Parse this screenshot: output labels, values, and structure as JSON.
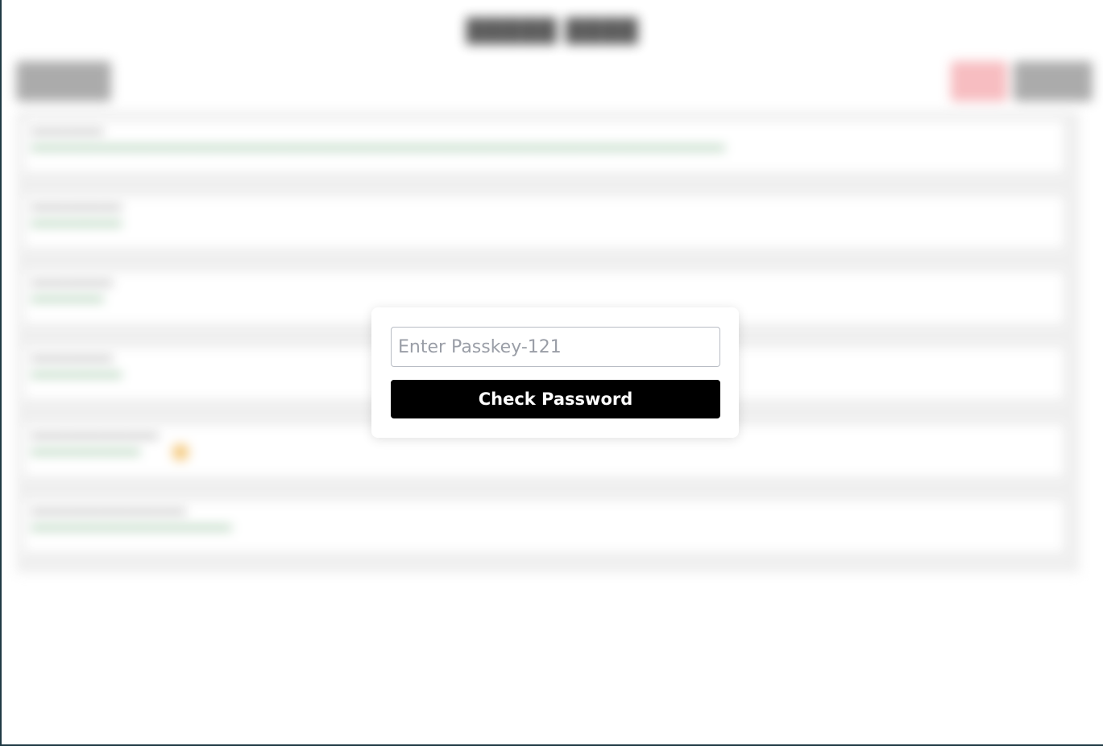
{
  "modal": {
    "input_placeholder": "Enter Passkey-121",
    "input_value": "",
    "button_label": "Check Password"
  },
  "colors": {
    "button_bg": "#000000",
    "button_text": "#ffffff",
    "background_accent_red": "#f4a3a8",
    "background_value_green": "#3b8c4a"
  }
}
